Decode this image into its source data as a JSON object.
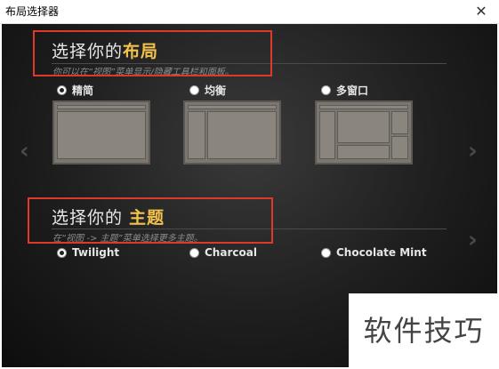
{
  "window": {
    "title": "布局选择器",
    "close_glyph": "✕"
  },
  "layout_section": {
    "title_prefix": "选择你的",
    "title_highlight": "布局",
    "subtitle": "你可以在“视图”菜单显示/隐藏工具栏和面板。",
    "options": [
      {
        "label": "精简",
        "selected": true
      },
      {
        "label": "均衡",
        "selected": false
      },
      {
        "label": "多窗口",
        "selected": false
      }
    ]
  },
  "theme_section": {
    "title_prefix": "选择你的 ",
    "title_highlight": "主题",
    "subtitle": "在“视图 -> 主题”菜单选择更多主题。",
    "options": [
      {
        "label": "Twilight",
        "selected": true
      },
      {
        "label": "Charcoal",
        "selected": false
      },
      {
        "label": "Chocolate Mint",
        "selected": false
      }
    ]
  },
  "nav": {
    "prev_glyph": "‹",
    "next_glyph": "›"
  },
  "watermark": {
    "text": "软件技巧"
  },
  "colors": {
    "highlight": "#f2c24b",
    "annotation": "#e0392c",
    "background": "#1e1e1e"
  }
}
